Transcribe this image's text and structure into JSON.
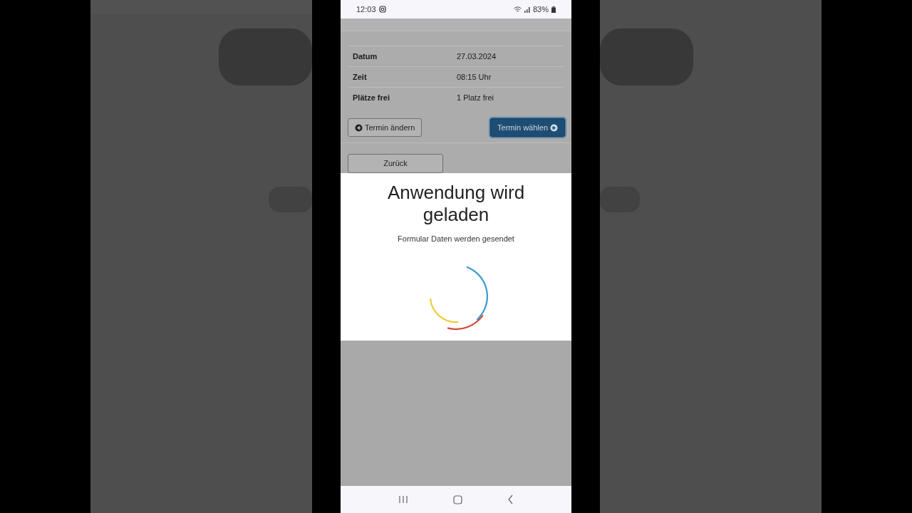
{
  "status_bar": {
    "time": "12:03",
    "battery": "83%"
  },
  "details": [
    {
      "label": "Datum",
      "value": "27.03.2024"
    },
    {
      "label": "Zeit",
      "value": "08:15 Uhr"
    },
    {
      "label": "Plätze frei",
      "value": "1 Platz frei"
    }
  ],
  "buttons": [
    {
      "label": "Termin ändern",
      "kind": "back"
    },
    {
      "label": "Termin wählen",
      "kind": "next"
    }
  ],
  "back_button": {
    "label": "Zurück"
  },
  "loading_dialog": {
    "title": "Anwendung wird geladen",
    "message": "Formular Daten werden gesendet"
  }
}
